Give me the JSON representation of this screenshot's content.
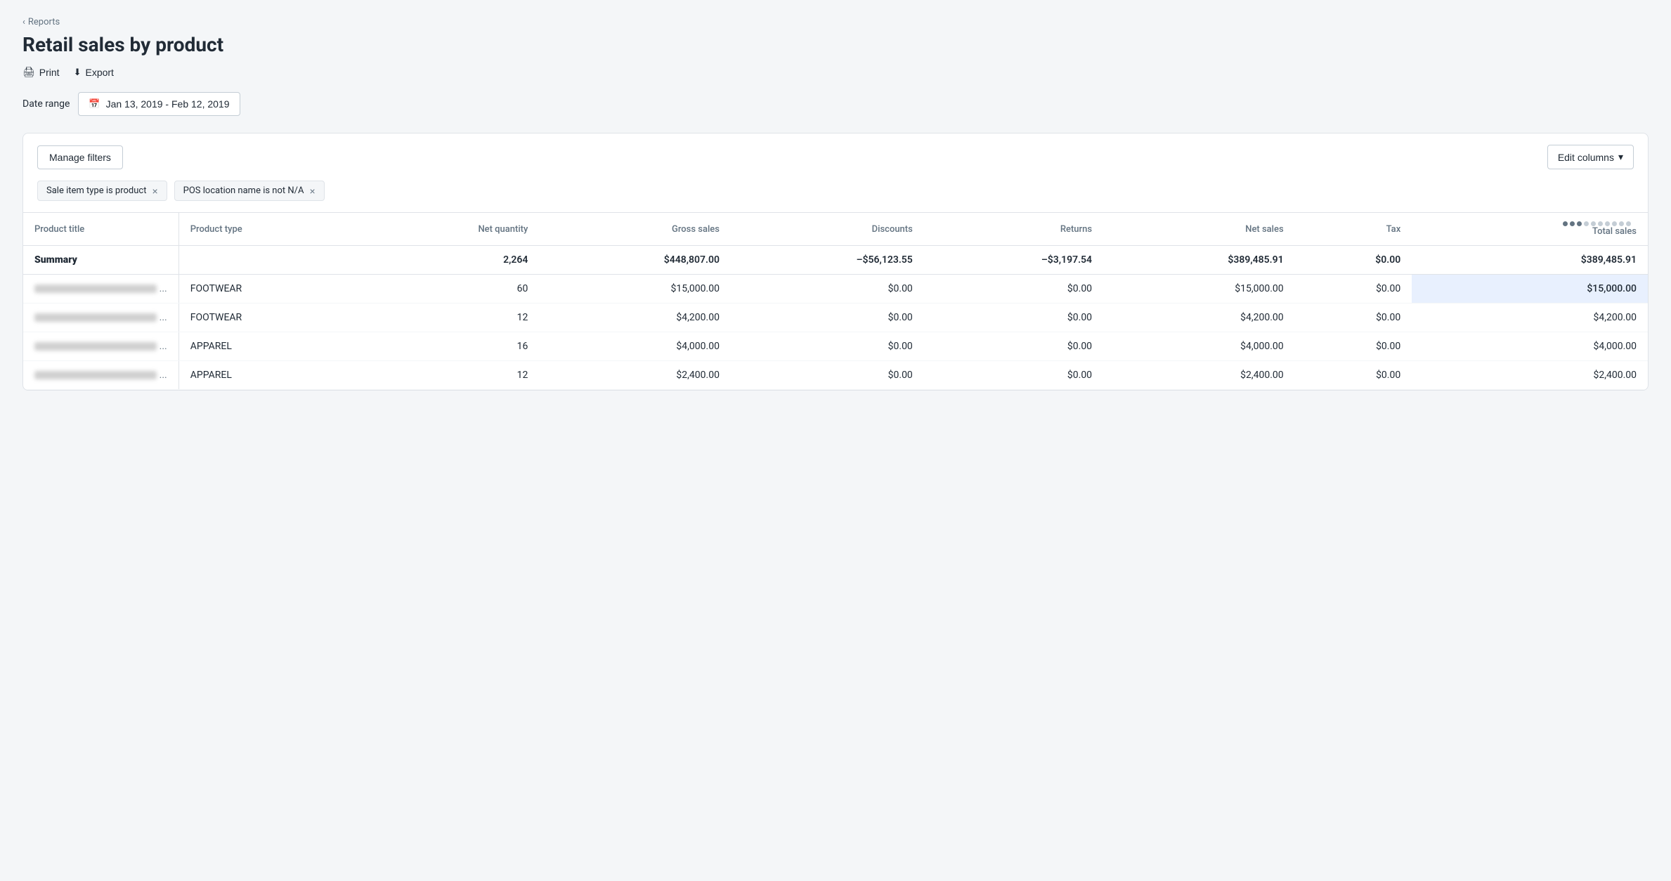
{
  "nav": {
    "back_label": "Reports"
  },
  "header": {
    "title": "Retail sales by product"
  },
  "toolbar": {
    "print_label": "Print",
    "export_label": "Export"
  },
  "date_range": {
    "label": "Date range",
    "value": "Jan 13, 2019 - Feb 12, 2019"
  },
  "filters_section": {
    "manage_filters_label": "Manage filters",
    "edit_columns_label": "Edit columns",
    "filters": [
      {
        "id": "filter-1",
        "label": "Sale item type is product"
      },
      {
        "id": "filter-2",
        "label": "POS location name is not N/A"
      }
    ]
  },
  "table": {
    "columns": [
      {
        "key": "product_title",
        "label": "Product title",
        "align": "left"
      },
      {
        "key": "product_type",
        "label": "Product type",
        "align": "left"
      },
      {
        "key": "net_quantity",
        "label": "Net quantity",
        "align": "right"
      },
      {
        "key": "gross_sales",
        "label": "Gross sales",
        "align": "right"
      },
      {
        "key": "discounts",
        "label": "Discounts",
        "align": "right"
      },
      {
        "key": "returns",
        "label": "Returns",
        "align": "right"
      },
      {
        "key": "net_sales",
        "label": "Net sales",
        "align": "right"
      },
      {
        "key": "tax",
        "label": "Tax",
        "align": "right"
      },
      {
        "key": "total_sales",
        "label": "Total sales",
        "align": "right"
      }
    ],
    "summary": {
      "label": "Summary",
      "net_quantity": "2,264",
      "gross_sales": "$448,807.00",
      "discounts": "–$56,123.55",
      "returns": "–$3,197.54",
      "net_sales": "$389,485.91",
      "tax": "$0.00",
      "total_sales": "$389,485.91"
    },
    "rows": [
      {
        "product_title": "blurred content ...",
        "product_type": "FOOTWEAR",
        "net_quantity": "60",
        "gross_sales": "$15,000.00",
        "discounts": "$0.00",
        "returns": "$0.00",
        "net_sales": "$15,000.00",
        "tax": "$0.00",
        "total_sales": "$15,000.00",
        "highlight": true
      },
      {
        "product_title": "blurred content...",
        "product_type": "FOOTWEAR",
        "net_quantity": "12",
        "gross_sales": "$4,200.00",
        "discounts": "$0.00",
        "returns": "$0.00",
        "net_sales": "$4,200.00",
        "tax": "$0.00",
        "total_sales": "$4,200.00",
        "highlight": false
      },
      {
        "product_title": "blurred content ...",
        "product_type": "APPAREL",
        "net_quantity": "16",
        "gross_sales": "$4,000.00",
        "discounts": "$0.00",
        "returns": "$0.00",
        "net_sales": "$4,000.00",
        "tax": "$0.00",
        "total_sales": "$4,000.00",
        "highlight": false
      },
      {
        "product_title": "blurred content ...",
        "product_type": "APPAREL",
        "net_quantity": "12",
        "gross_sales": "$2,400.00",
        "discounts": "$0.00",
        "returns": "$0.00",
        "net_sales": "$2,400.00",
        "tax": "$0.00",
        "total_sales": "$2,400.00",
        "highlight": false
      }
    ]
  },
  "icons": {
    "chevron_left": "‹",
    "print": "🖨",
    "export": "⬇",
    "calendar": "📅",
    "chevron_down": "▾",
    "close": "×"
  }
}
